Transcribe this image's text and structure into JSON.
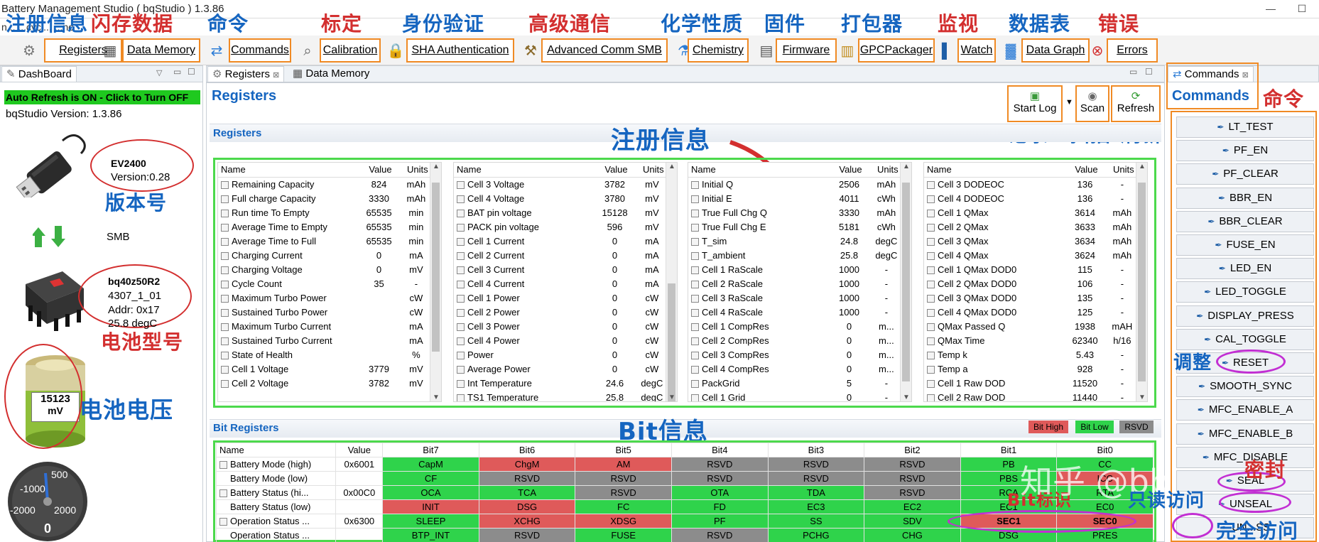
{
  "window": {
    "title": "Battery Management Studio ( bqStudio ) 1.3.86",
    "subtitle_fragment": "n... ...cycl... ...no",
    "min_label": "—",
    "max_label": "☐"
  },
  "toolbar": {
    "buttons": [
      {
        "label": "Registers",
        "icon": "gear-icon"
      },
      {
        "label": "Data Memory",
        "icon": "chip-icon"
      },
      {
        "label": "Commands",
        "icon": "arrows-icon"
      },
      {
        "label": "Calibration",
        "icon": "magnifier-icon"
      },
      {
        "label": "SHA Authentication",
        "icon": "lock-icon"
      },
      {
        "label": "Advanced Comm SMB",
        "icon": "tools-icon"
      },
      {
        "label": "Chemistry",
        "icon": "flask-icon"
      },
      {
        "label": "Firmware",
        "icon": "firmware-icon"
      },
      {
        "label": "GPCPackager",
        "icon": "package-icon"
      },
      {
        "label": "Watch",
        "icon": "book-icon"
      },
      {
        "label": "Data Graph",
        "icon": "graph-icon"
      },
      {
        "label": "Errors",
        "icon": "error-icon"
      }
    ],
    "annotations": [
      "注册信息",
      "闪存数据",
      "命令",
      "标定",
      "身份验证",
      "高级通信",
      "化学性质",
      "固件",
      "打包器",
      "监视",
      "数据表",
      "错误"
    ]
  },
  "dashboard": {
    "tab_label": "DashBoard",
    "auto_refresh": "Auto Refresh is ON - Click to Turn OFF",
    "version_line": "bqStudio Version:  1.3.86",
    "adapter_name": "EV2400",
    "adapter_version": "Version:0.28",
    "bus": "SMB",
    "device_name": "bq40z50R2",
    "device_fw": "4307_1_01",
    "device_addr": "Addr: 0x17",
    "device_temp": "25.8 degC",
    "voltage_value": "15123",
    "voltage_unit": "mV",
    "gauge_labels": [
      "500",
      "-1000",
      "-2000",
      "2000",
      "0"
    ],
    "ann_version": "版本号",
    "ann_model": "电池型号",
    "ann_voltage": "电池电压"
  },
  "center": {
    "tabs": [
      "Registers",
      "Data Memory"
    ],
    "title": "Registers",
    "subsection": "Registers",
    "start_log": "Start Log",
    "scan": "Scan",
    "refresh": "Refresh",
    "ann_register": "注册信息",
    "ann_log": "记录",
    "ann_scan": "扫描",
    "ann_refresh": "刷新",
    "table_headers": [
      "Name",
      "Value",
      "Units"
    ],
    "tables": [
      [
        [
          "Remaining Capacity",
          "824",
          "mAh"
        ],
        [
          "Full charge Capacity",
          "3330",
          "mAh"
        ],
        [
          "Run time To Empty",
          "65535",
          "min"
        ],
        [
          "Average Time to Empty",
          "65535",
          "min"
        ],
        [
          "Average Time to Full",
          "65535",
          "min"
        ],
        [
          "Charging Current",
          "0",
          "mA"
        ],
        [
          "Charging Voltage",
          "0",
          "mV"
        ],
        [
          "Cycle Count",
          "35",
          "-"
        ],
        [
          "Maximum Turbo Power",
          "",
          "cW"
        ],
        [
          "Sustained Turbo Power",
          "",
          "cW"
        ],
        [
          "Maximum Turbo Current",
          "",
          "mA"
        ],
        [
          "Sustained Turbo Current",
          "",
          "mA"
        ],
        [
          "State of Health",
          "",
          "%"
        ],
        [
          "Cell 1 Voltage",
          "3779",
          "mV"
        ],
        [
          "Cell 2 Voltage",
          "3782",
          "mV"
        ]
      ],
      [
        [
          "Cell 3 Voltage",
          "3782",
          "mV"
        ],
        [
          "Cell 4 Voltage",
          "3780",
          "mV"
        ],
        [
          "BAT pin voltage",
          "15128",
          "mV"
        ],
        [
          "PACK pin voltage",
          "596",
          "mV"
        ],
        [
          "Cell 1 Current",
          "0",
          "mA"
        ],
        [
          "Cell 2 Current",
          "0",
          "mA"
        ],
        [
          "Cell 3 Current",
          "0",
          "mA"
        ],
        [
          "Cell 4 Current",
          "0",
          "mA"
        ],
        [
          "Cell 1 Power",
          "0",
          "cW"
        ],
        [
          "Cell 2 Power",
          "0",
          "cW"
        ],
        [
          "Cell 3 Power",
          "0",
          "cW"
        ],
        [
          "Cell 4 Power",
          "0",
          "cW"
        ],
        [
          "Power",
          "0",
          "cW"
        ],
        [
          "Average Power",
          "0",
          "cW"
        ],
        [
          "Int Temperature",
          "24.6",
          "degC"
        ],
        [
          "TS1 Temperature",
          "25.8",
          "degC"
        ]
      ],
      [
        [
          "Initial Q",
          "2506",
          "mAh"
        ],
        [
          "Initial E",
          "4011",
          "cWh"
        ],
        [
          "True Full Chg Q",
          "3330",
          "mAh"
        ],
        [
          "True Full Chg E",
          "5181",
          "cWh"
        ],
        [
          "T_sim",
          "24.8",
          "degC"
        ],
        [
          "T_ambient",
          "25.8",
          "degC"
        ],
        [
          "Cell 1 RaScale",
          "1000",
          "-"
        ],
        [
          "Cell 2 RaScale",
          "1000",
          "-"
        ],
        [
          "Cell 3 RaScale",
          "1000",
          "-"
        ],
        [
          "Cell 4 RaScale",
          "1000",
          "-"
        ],
        [
          "Cell 1 CompRes",
          "0",
          "m..."
        ],
        [
          "Cell 2 CompRes",
          "0",
          "m..."
        ],
        [
          "Cell 3 CompRes",
          "0",
          "m..."
        ],
        [
          "Cell 4 CompRes",
          "0",
          "m..."
        ],
        [
          "PackGrid",
          "5",
          "-"
        ],
        [
          "Cell 1 Grid",
          "0",
          "-"
        ]
      ],
      [
        [
          "Cell 3 DODEOC",
          "136",
          "-"
        ],
        [
          "Cell 4 DODEOC",
          "136",
          "-"
        ],
        [
          "Cell 1 QMax",
          "3614",
          "mAh"
        ],
        [
          "Cell 2 QMax",
          "3633",
          "mAh"
        ],
        [
          "Cell 3 QMax",
          "3634",
          "mAh"
        ],
        [
          "Cell 4 QMax",
          "3624",
          "mAh"
        ],
        [
          "Cell 1 QMax DOD0",
          "115",
          "-"
        ],
        [
          "Cell 2 QMax DOD0",
          "106",
          "-"
        ],
        [
          "Cell 3 QMax DOD0",
          "135",
          "-"
        ],
        [
          "Cell 4 QMax DOD0",
          "125",
          "-"
        ],
        [
          "QMax Passed Q",
          "1938",
          "mAH"
        ],
        [
          "QMax Time",
          "62340",
          "h/16"
        ],
        [
          "Temp k",
          "5.43",
          "-"
        ],
        [
          "Temp a",
          "928",
          "-"
        ],
        [
          "Cell 1 Raw DOD",
          "11520",
          "-"
        ],
        [
          "Cell 2 Raw DOD",
          "11440",
          "-"
        ]
      ]
    ],
    "bit_section": "Bit Registers",
    "ann_bit": "Bit信息",
    "legend": [
      "Bit High",
      "Bit Low",
      "RSVD"
    ],
    "bit_headers": [
      "Name",
      "Value",
      "Bit7",
      "Bit6",
      "Bit5",
      "Bit4",
      "Bit3",
      "Bit2",
      "Bit1",
      "Bit0"
    ],
    "bit_rows": [
      {
        "name": "Battery Mode (high)",
        "value": "0x6001",
        "bits": [
          "CapM",
          "ChgM",
          "AM",
          "RSVD",
          "RSVD",
          "RSVD",
          "PB",
          "CC"
        ],
        "colors": [
          "g",
          "r",
          "r",
          "x",
          "x",
          "x",
          "g",
          "g"
        ]
      },
      {
        "name": "Battery Mode (low)",
        "value": "",
        "bits": [
          "CF",
          "RSVD",
          "RSVD",
          "RSVD",
          "RSVD",
          "RSVD",
          "PBS",
          "ICC"
        ],
        "colors": [
          "g",
          "x",
          "x",
          "x",
          "x",
          "x",
          "g",
          "r"
        ]
      },
      {
        "name": "Battery Status (hi...",
        "value": "0x00C0",
        "bits": [
          "OCA",
          "TCA",
          "RSVD",
          "OTA",
          "TDA",
          "RSVD",
          "RCA",
          "RTA"
        ],
        "colors": [
          "g",
          "g",
          "x",
          "g",
          "g",
          "x",
          "g",
          "g"
        ]
      },
      {
        "name": "Battery Status (low)",
        "value": "",
        "bits": [
          "INIT",
          "DSG",
          "FC",
          "FD",
          "EC3",
          "EC2",
          "EC1",
          "EC0"
        ],
        "colors": [
          "r",
          "r",
          "g",
          "g",
          "g",
          "g",
          "g",
          "g"
        ]
      },
      {
        "name": "Operation Status ...",
        "value": "0x6300",
        "bits": [
          "SLEEP",
          "XCHG",
          "XDSG",
          "PF",
          "SS",
          "SDV",
          "SEC1",
          "SEC0"
        ],
        "colors": [
          "g",
          "r",
          "r",
          "g",
          "g",
          "g",
          "r",
          "r"
        ]
      },
      {
        "name": "Operation Status ...",
        "value": "",
        "bits": [
          "BTP_INT",
          "RSVD",
          "FUSE",
          "RSVD",
          "PCHG",
          "CHG",
          "DSG",
          "PRES"
        ],
        "colors": [
          "g",
          "x",
          "g",
          "x",
          "g",
          "g",
          "g",
          "g"
        ]
      }
    ],
    "ann_bit_flag": "Bit标识",
    "watermark": "知乎 @bbsgyd"
  },
  "commands": {
    "tab_label": "Commands",
    "title": "Commands",
    "ann_title": "命令",
    "items": [
      "LT_TEST",
      "PF_EN",
      "PF_CLEAR",
      "BBR_EN",
      "BBR_CLEAR",
      "FUSE_EN",
      "LED_EN",
      "LED_TOGGLE",
      "DISPLAY_PRESS",
      "CAL_TOGGLE",
      "RESET",
      "SMOOTH_SYNC",
      "MFC_ENABLE_A",
      "MFC_ENABLE_B",
      "MFC_DISABLE",
      "SEAL",
      "UNSEAL",
      "UNSEAL_FULL"
    ],
    "visible_labels": [
      "LT_TEST",
      "PF_EN",
      "PF_CLEAR",
      "BBR_EN",
      "BBR_CLEAR",
      "FUSE_EN",
      "LED_EN",
      "LED_TOGGLE",
      "DISPLAY_PRESS",
      "CAL_TOGGLE",
      "RESET",
      "SMOOTH_SYNC",
      "MFC_ENABLE_A",
      "MFC_ENABLE_B",
      "MFC_DISABLE",
      "SEAL",
      "UNSEAL",
      "UN...SS"
    ],
    "ann_adjust": "调整",
    "ann_seal": "密封",
    "ann_readonly": "只读访问",
    "ann_full": "完全访问"
  },
  "colors": {
    "accent": "#f08a24",
    "annotation": "#1565c0",
    "highlight": "#4cd94c",
    "bit_high": "#df5a5a",
    "bit_low": "#2fd34b",
    "rsvd": "#8c8c8c"
  }
}
